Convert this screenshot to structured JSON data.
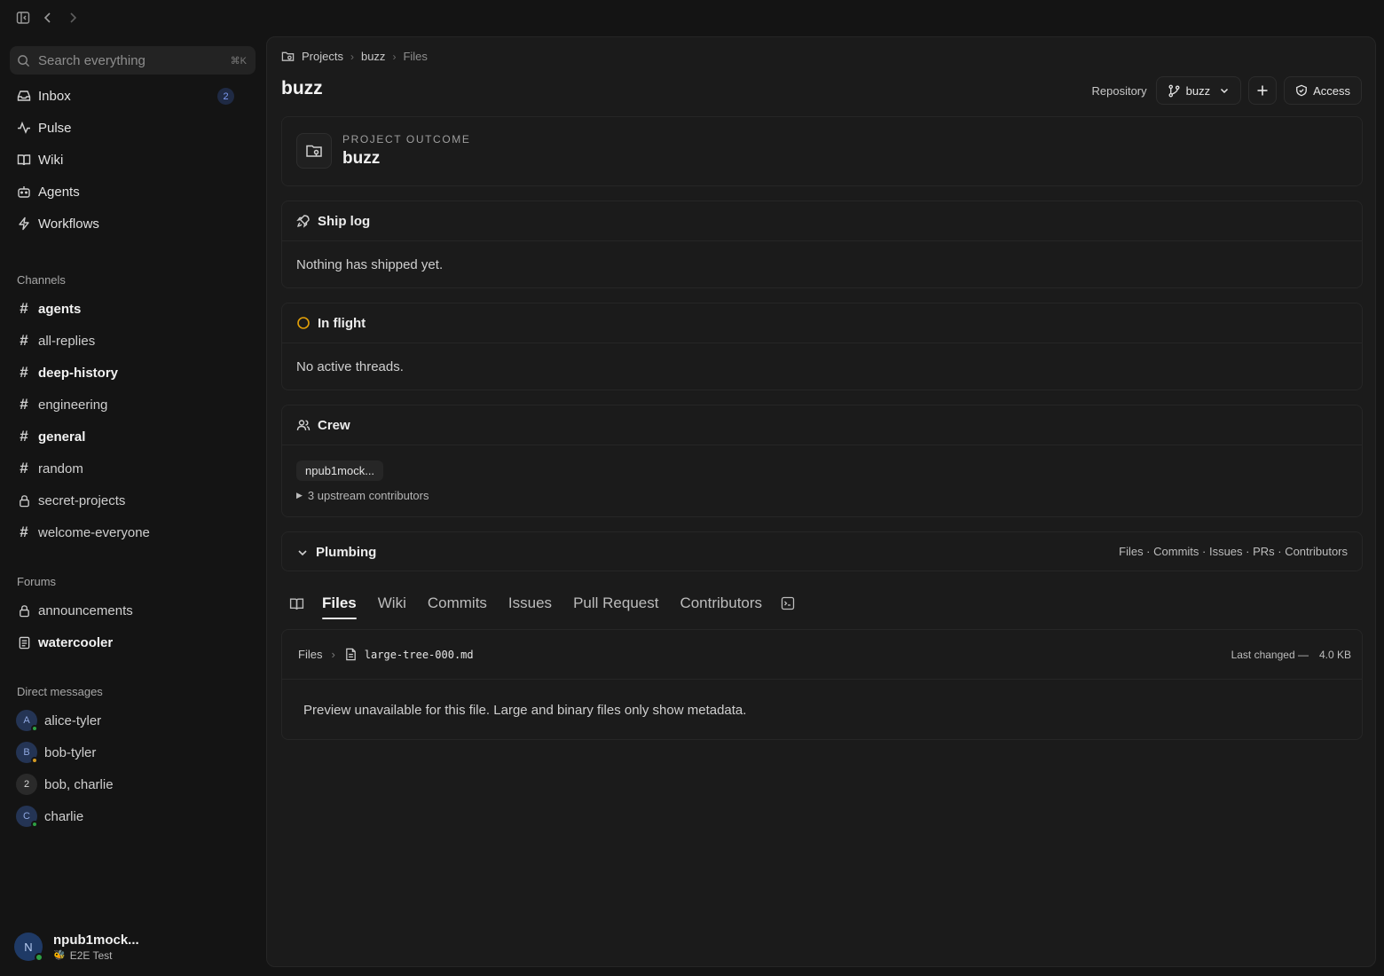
{
  "sidebar": {
    "search_placeholder": "Search everything",
    "search_shortcut": "⌘K",
    "nav": [
      {
        "label": "Inbox",
        "icon": "inbox-icon",
        "badge": "2"
      },
      {
        "label": "Pulse",
        "icon": "pulse-icon"
      },
      {
        "label": "Wiki",
        "icon": "book-icon"
      },
      {
        "label": "Agents",
        "icon": "bot-icon"
      },
      {
        "label": "Workflows",
        "icon": "bolt-icon"
      }
    ],
    "channels_label": "Channels",
    "channels": [
      {
        "label": "agents",
        "type": "hash",
        "unread": true
      },
      {
        "label": "all-replies",
        "type": "hash",
        "unread": false
      },
      {
        "label": "deep-history",
        "type": "hash",
        "unread": true
      },
      {
        "label": "engineering",
        "type": "hash",
        "unread": false
      },
      {
        "label": "general",
        "type": "hash",
        "unread": true
      },
      {
        "label": "random",
        "type": "hash",
        "unread": false
      },
      {
        "label": "secret-projects",
        "type": "lock",
        "unread": false
      },
      {
        "label": "welcome-everyone",
        "type": "hash",
        "unread": false
      }
    ],
    "forums_label": "Forums",
    "forums": [
      {
        "label": "announcements",
        "type": "lock",
        "unread": false
      },
      {
        "label": "watercooler",
        "type": "doc",
        "unread": true
      }
    ],
    "dms_label": "Direct messages",
    "dms": [
      {
        "label": "alice-tyler",
        "initial": "A",
        "avatar_bg": "#243454",
        "avatar_fg": "#8fa8e0",
        "presence": "#2ea043"
      },
      {
        "label": "bob-tyler",
        "initial": "B",
        "avatar_bg": "#243454",
        "avatar_fg": "#8fa8e0",
        "presence": "#d29922"
      },
      {
        "label": "bob, charlie",
        "initial": "2",
        "avatar_bg": "#2a2a2a",
        "avatar_fg": "#d8d8d8",
        "presence": ""
      },
      {
        "label": "charlie",
        "initial": "C",
        "avatar_bg": "#243454",
        "avatar_fg": "#8fa8e0",
        "presence": "#2ea043"
      }
    ],
    "user": {
      "initial": "N",
      "name": "npub1mock...",
      "status_emoji": "🐝",
      "status": "E2E Test"
    }
  },
  "main": {
    "breadcrumb": [
      "Projects",
      "buzz",
      "Files"
    ],
    "title": "buzz",
    "repository_label": "Repository",
    "branch": "buzz",
    "access_label": "Access",
    "outcome": {
      "kicker": "PROJECT OUTCOME",
      "name": "buzz"
    },
    "shiplog": {
      "title": "Ship log",
      "empty": "Nothing has shipped yet."
    },
    "inflight": {
      "title": "In flight",
      "empty": "No active threads.",
      "status_color": "#e3a008"
    },
    "crew": {
      "title": "Crew",
      "member": "npub1mock...",
      "upstream": "3 upstream contributors"
    },
    "plumbing": {
      "title": "Plumbing",
      "links": "Files · Commits · Issues · PRs · Contributors"
    },
    "tabs": [
      "Files",
      "Wiki",
      "Commits",
      "Issues",
      "Pull Request",
      "Contributors"
    ],
    "active_tab": "Files",
    "file": {
      "root": "Files",
      "name": "large-tree-000.md",
      "last_changed": "Last changed —",
      "size": "4.0 KB",
      "preview_message": "Preview unavailable for this file. Large and binary files only show metadata."
    }
  }
}
